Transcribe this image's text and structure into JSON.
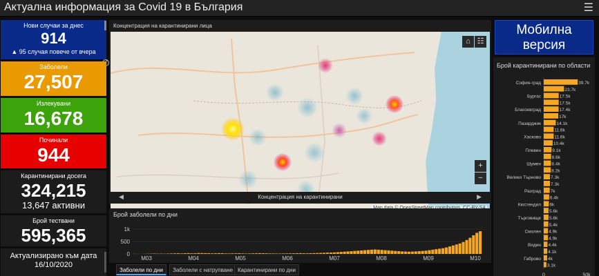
{
  "header": {
    "title": "Актуална информация за Covid 19 в България",
    "menu_icon": "hamburger-icon"
  },
  "cards": {
    "new_cases": {
      "label": "Нови случаи за днес",
      "value": "914",
      "note": "▲ 95 случая повече от вчера"
    },
    "infected": {
      "label": "Заболели",
      "value": "27,507"
    },
    "recovered": {
      "label": "Излекувани",
      "value": "16,678"
    },
    "deceased": {
      "label": "Починали",
      "value": "944"
    },
    "quarantined": {
      "label": "Карантинирани досега",
      "value": "324,215",
      "note": "13,647 активни"
    },
    "tests": {
      "label": "Брой тествани",
      "value": "595,365"
    },
    "updated": {
      "label": "Актуализирано към дата",
      "value": "16/10/2020"
    }
  },
  "colors": {
    "new_cases": "#0a2a8a",
    "infected": "#e89a00",
    "recovered": "#3da30a",
    "deceased": "#e60000",
    "bar": "#f5a623"
  },
  "map": {
    "title": "Концентрация на карантинирани лица",
    "caption": "Концентрация на карантинирани",
    "attribution": "Map data © OpenStreetMap contributors, CC-BY-SA",
    "zoom_in": "+",
    "zoom_out": "−",
    "home_icon": "home-icon",
    "legend_icon": "list-icon",
    "prev_arrow": "◀",
    "next_arrow": "▶"
  },
  "mobile": {
    "line1": "Мобилна",
    "line2": "версия"
  },
  "tabs": [
    "Заболели по дни",
    "Заболели с натрупване",
    "Карантинирани по дни"
  ],
  "chart_data": [
    {
      "type": "bar",
      "title": "Брой заболели по дни",
      "xlabel": "",
      "ylabel": "",
      "y_ticks": [
        "1k",
        "500",
        "0"
      ],
      "ylim": [
        0,
        1000
      ],
      "x_ticks": [
        "M03",
        "M04",
        "M05",
        "M06",
        "M07",
        "M08",
        "M09",
        "M10"
      ],
      "series": [
        {
          "values": [
            4,
            2,
            1,
            3,
            7,
            10,
            15,
            11,
            12,
            9,
            14,
            18,
            22,
            25,
            20,
            28,
            30,
            24,
            26,
            35,
            32,
            29,
            27,
            22,
            25,
            30,
            28,
            20,
            18,
            22,
            24,
            26,
            20,
            15,
            18,
            22,
            25,
            30,
            28,
            24,
            20,
            18,
            16,
            15,
            18,
            20,
            22,
            25,
            28,
            30,
            26,
            24,
            28,
            32,
            35,
            40,
            45,
            50,
            55,
            60,
            70,
            80,
            90,
            100,
            110,
            120,
            130,
            140,
            150,
            160,
            170,
            180,
            170,
            160,
            150,
            140,
            130,
            120,
            110,
            100,
            95,
            90,
            95,
            100,
            110,
            120,
            130,
            150,
            170,
            190,
            210,
            230,
            260,
            300,
            340,
            380,
            420,
            480,
            560,
            650,
            750,
            850,
            914
          ]
        }
      ]
    },
    {
      "type": "bar",
      "title": "Брой карантинирани по области",
      "categories": [
        "София-град",
        "",
        "Бургас",
        "",
        "Благоевград",
        "",
        "Пазарджик",
        "",
        "Хасково",
        "",
        "Плевен",
        "",
        "Шумен",
        "",
        "Велико Търново",
        "",
        "Разград",
        "",
        "Кюстендил",
        "",
        "Търговище",
        "",
        "Смолян",
        "",
        "Видин",
        "",
        "Габрово",
        ""
      ],
      "values": [
        39.7,
        23.7,
        17.5,
        17.5,
        17.4,
        17,
        14.1,
        11.6,
        11.6,
        10.4,
        9.1,
        8.6,
        8.4,
        8.2,
        7.3,
        7.3,
        7,
        6.4,
        6,
        5.6,
        5.6,
        5.4,
        4.9,
        4.9,
        4.4,
        4.1,
        4,
        3.1
      ],
      "value_labels": [
        "39.7k",
        "23.7k",
        "17.5k",
        "17.5k",
        "17.4k",
        "17k",
        "14.1k",
        "11.6k",
        "11.6k",
        "10.4k",
        "9.1k",
        "8.6k",
        "8.4k",
        "8.2k",
        "7.3k",
        "7.3k",
        "7k",
        "6.4k",
        "6k",
        "5.6k",
        "5.6k",
        "5.4k",
        "4.9k",
        "4.9k",
        "4.4k",
        "4.1k",
        "4k",
        "3.1k"
      ],
      "x_ticks": [
        "0",
        "50k"
      ],
      "xlim": [
        0,
        50
      ]
    }
  ]
}
